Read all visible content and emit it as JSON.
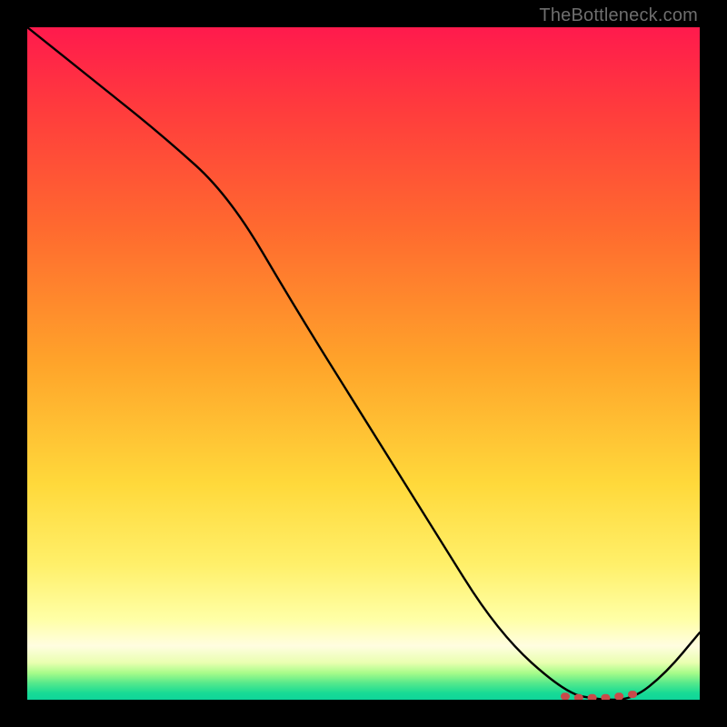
{
  "attribution": "TheBottleneck.com",
  "chart_data": {
    "type": "line",
    "title": "",
    "xlabel": "",
    "ylabel": "",
    "xlim": [
      0,
      100
    ],
    "ylim": [
      0,
      100
    ],
    "grid": false,
    "legend": false,
    "background_gradient": {
      "stops": [
        {
          "pos": 0.0,
          "color": "#ff1a4d"
        },
        {
          "pos": 0.12,
          "color": "#ff3b3d"
        },
        {
          "pos": 0.3,
          "color": "#ff6a2f"
        },
        {
          "pos": 0.5,
          "color": "#ffa42a"
        },
        {
          "pos": 0.68,
          "color": "#ffd93b"
        },
        {
          "pos": 0.8,
          "color": "#fff06a"
        },
        {
          "pos": 0.88,
          "color": "#ffffa6"
        },
        {
          "pos": 0.92,
          "color": "#fffde0"
        },
        {
          "pos": 0.945,
          "color": "#e9ffb0"
        },
        {
          "pos": 0.96,
          "color": "#a8fc8a"
        },
        {
          "pos": 0.975,
          "color": "#57e98b"
        },
        {
          "pos": 0.99,
          "color": "#18db95"
        },
        {
          "pos": 1.0,
          "color": "#0fd59a"
        }
      ]
    },
    "series": [
      {
        "name": "curve",
        "color": "#000000",
        "stroke_width": 2.4,
        "x": [
          0,
          10,
          20,
          30,
          40,
          50,
          60,
          70,
          80,
          85,
          90,
          95,
          100
        ],
        "y": [
          100,
          92,
          84,
          75,
          58,
          42,
          26,
          10,
          1,
          0,
          0,
          4,
          10
        ]
      }
    ],
    "markers": {
      "name": "valley-cluster",
      "color": "#c84a4a",
      "shape": "rounded",
      "x": [
        80,
        82,
        84,
        86,
        88,
        90
      ],
      "y": [
        0.5,
        0.3,
        0.3,
        0.3,
        0.5,
        0.8
      ]
    },
    "frame": {
      "outer_color": "#000000",
      "inner_size_px": 740,
      "outer_size_px": 800
    }
  }
}
